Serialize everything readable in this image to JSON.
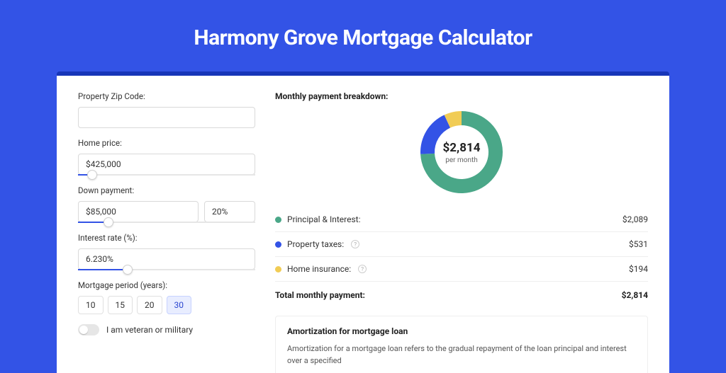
{
  "page": {
    "title": "Harmony Grove Mortgage Calculator"
  },
  "form": {
    "zip_label": "Property Zip Code:",
    "zip_value": "",
    "home_price_label": "Home price:",
    "home_price_value": "$425,000",
    "home_price_slider_pct": 8,
    "down_payment_label": "Down payment:",
    "down_payment_value": "$85,000",
    "down_payment_pct_value": "20%",
    "down_payment_slider_pct": 17,
    "interest_label": "Interest rate (%):",
    "interest_value": "6.230%",
    "interest_slider_pct": 28,
    "period_label": "Mortgage period (years):",
    "periods": [
      "10",
      "15",
      "20",
      "30"
    ],
    "period_selected_index": 3,
    "veteran_label": "I am veteran or military"
  },
  "breakdown": {
    "title": "Monthly payment breakdown:",
    "center_amount": "$2,814",
    "center_sub": "per month",
    "items": [
      {
        "label": "Principal & Interest:",
        "value": "$2,089",
        "color": "#4aa788",
        "has_info": false
      },
      {
        "label": "Property taxes:",
        "value": "$531",
        "color": "#3353e6",
        "has_info": true
      },
      {
        "label": "Home insurance:",
        "value": "$194",
        "color": "#f1cc55",
        "has_info": true
      }
    ],
    "total_label": "Total monthly payment:",
    "total_value": "$2,814"
  },
  "amortization": {
    "title": "Amortization for mortgage loan",
    "text": "Amortization for a mortgage loan refers to the gradual repayment of the loan principal and interest over a specified"
  },
  "chart_data": {
    "type": "pie",
    "title": "Monthly payment breakdown",
    "series": [
      {
        "name": "Principal & Interest",
        "value": 2089,
        "color": "#4aa788"
      },
      {
        "name": "Property taxes",
        "value": 531,
        "color": "#3353e6"
      },
      {
        "name": "Home insurance",
        "value": 194,
        "color": "#f1cc55"
      }
    ],
    "total": 2814,
    "unit": "USD per month"
  }
}
